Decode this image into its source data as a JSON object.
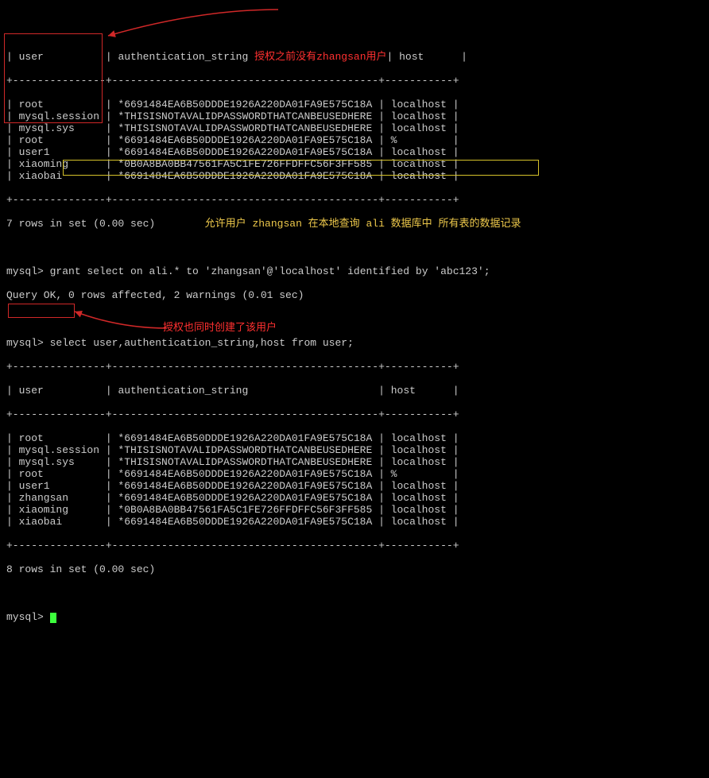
{
  "header": {
    "c1": "user",
    "c2": "authentication_string",
    "c3": "host"
  },
  "ann": {
    "before": "授权之前没有zhangsan用户",
    "allow": "允许用户 zhangsan 在本地查询 ali 数据库中 所有表的数据记录",
    "created": "授权也同时创建了该用户"
  },
  "sep_top": "+---------------+-------------------------------------------+-----------+",
  "table1_rows": [
    {
      "user": "root",
      "auth": "*6691484EA6B50DDDE1926A220DA01FA9E575C18A",
      "host": "localhost"
    },
    {
      "user": "mysql.session",
      "auth": "*THISISNOTAVALIDPASSWORDTHATCANBEUSEDHERE",
      "host": "localhost"
    },
    {
      "user": "mysql.sys",
      "auth": "*THISISNOTAVALIDPASSWORDTHATCANBEUSEDHERE",
      "host": "localhost"
    },
    {
      "user": "root",
      "auth": "*6691484EA6B50DDDE1926A220DA01FA9E575C18A",
      "host": "%"
    },
    {
      "user": "user1",
      "auth": "*6691484EA6B50DDDE1926A220DA01FA9E575C18A",
      "host": "localhost"
    },
    {
      "user": "xiaoming",
      "auth": "*0B0A8BA0BB47561FA5C1FE726FFDFFC56F3FF585",
      "host": "localhost"
    },
    {
      "user": "xiaobai",
      "auth": "*6691484EA6B50DDDE1926A220DA01FA9E575C18A",
      "host": "localhost"
    }
  ],
  "rows1_msg": "7 rows in set (0.00 sec)",
  "prompt": "mysql>",
  "grant_cmd": "grant select on ali.* to 'zhangsan'@'localhost' identified by 'abc123';",
  "grant_result": "Query OK, 0 rows affected, 2 warnings (0.01 sec)",
  "select_cmd": "select user,authentication_string,host from user;",
  "table2_rows": [
    {
      "user": "root",
      "auth": "*6691484EA6B50DDDE1926A220DA01FA9E575C18A",
      "host": "localhost"
    },
    {
      "user": "mysql.session",
      "auth": "*THISISNOTAVALIDPASSWORDTHATCANBEUSEDHERE",
      "host": "localhost"
    },
    {
      "user": "mysql.sys",
      "auth": "*THISISNOTAVALIDPASSWORDTHATCANBEUSEDHERE",
      "host": "localhost"
    },
    {
      "user": "root",
      "auth": "*6691484EA6B50DDDE1926A220DA01FA9E575C18A",
      "host": "%"
    },
    {
      "user": "user1",
      "auth": "*6691484EA6B50DDDE1926A220DA01FA9E575C18A",
      "host": "localhost"
    },
    {
      "user": "zhangsan",
      "auth": "*6691484EA6B50DDDE1926A220DA01FA9E575C18A",
      "host": "localhost"
    },
    {
      "user": "xiaoming",
      "auth": "*0B0A8BA0BB47561FA5C1FE726FFDFFC56F3FF585",
      "host": "localhost"
    },
    {
      "user": "xiaobai",
      "auth": "*6691484EA6B50DDDE1926A220DA01FA9E575C18A",
      "host": "localhost"
    }
  ],
  "rows2_msg": "8 rows in set (0.00 sec)"
}
